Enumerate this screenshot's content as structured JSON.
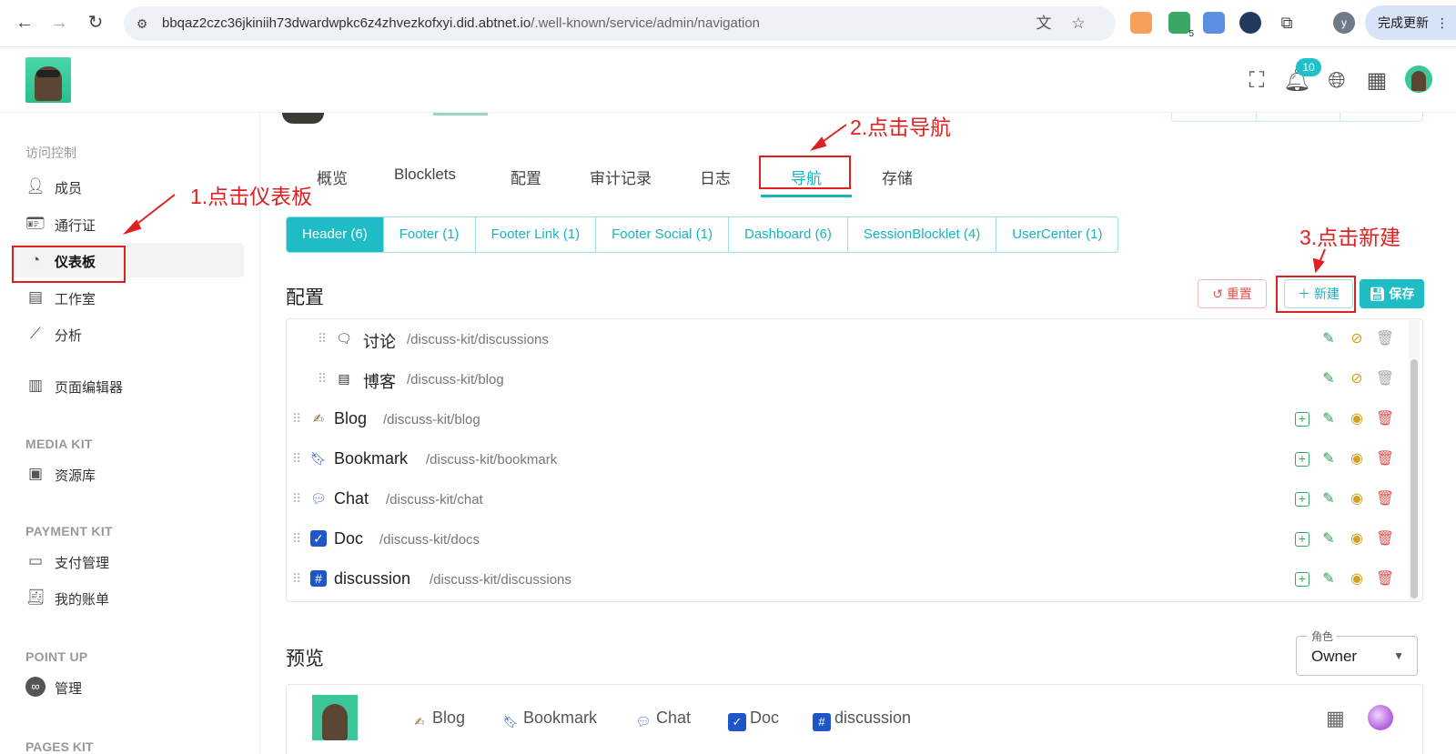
{
  "browser": {
    "url_host": "bbqaz2czc36jkiniih73dwardwpkc6z4zhvezkofxyi.did.abtnet.io",
    "url_path": "/.well-known/service/admin/navigation",
    "update_label": "完成更新",
    "profile_initial": "y",
    "ext_badge": "5"
  },
  "header": {
    "notification_count": "10"
  },
  "sidebar": {
    "group_access": "访问控制",
    "items_access": [
      {
        "label": "成员",
        "icon": "user-icon"
      },
      {
        "label": "通行证",
        "icon": "badge-icon"
      },
      {
        "label": "仪表板",
        "icon": "dashboard-icon"
      },
      {
        "label": "工作室",
        "icon": "studio-icon"
      },
      {
        "label": "分析",
        "icon": "analytics-icon"
      }
    ],
    "page_editor": "页面编辑器",
    "group_media": "MEDIA KIT",
    "media_library": "资源库",
    "group_payment": "PAYMENT KIT",
    "payment_manage": "支付管理",
    "my_bills": "我的账单",
    "group_point": "POINT UP",
    "point_manage": "管理",
    "group_pages": "PAGES KIT"
  },
  "tabs": [
    "概览",
    "Blocklets",
    "配置",
    "审计记录",
    "日志",
    "导航",
    "存储"
  ],
  "segments": [
    "Header (6)",
    "Footer (1)",
    "Footer Link (1)",
    "Footer Social (1)",
    "Dashboard (6)",
    "SessionBlocklet (4)",
    "UserCenter (1)"
  ],
  "config": {
    "title": "配置",
    "reset_label": "重置",
    "new_label": "新建",
    "save_label": "保存"
  },
  "nav_rows": [
    {
      "name": "讨论",
      "path": "/discuss-kit/discussions",
      "child": true
    },
    {
      "name": "博客",
      "path": "/discuss-kit/blog",
      "child": true
    },
    {
      "name": "Blog",
      "path": "/discuss-kit/blog",
      "child": false
    },
    {
      "name": "Bookmark",
      "path": "/discuss-kit/bookmark",
      "child": false
    },
    {
      "name": "Chat",
      "path": "/discuss-kit/chat",
      "child": false
    },
    {
      "name": "Doc",
      "path": "/discuss-kit/docs",
      "child": false
    },
    {
      "name": "discussion",
      "path": "/discuss-kit/discussions",
      "child": false
    }
  ],
  "preview": {
    "title": "预览",
    "role_label": "角色",
    "role_value": "Owner",
    "items": [
      "Blog",
      "Bookmark",
      "Chat",
      "Doc",
      "discussion"
    ]
  },
  "annotations": {
    "step1": "1.点击仪表板",
    "step2": "2.点击导航",
    "step3": "3.点击新建"
  },
  "colors": {
    "accent": "#1fbcc6",
    "annotation": "#e02020",
    "danger": "#e05252",
    "edit": "#2e9d5a",
    "visibility": "#d4a020"
  }
}
